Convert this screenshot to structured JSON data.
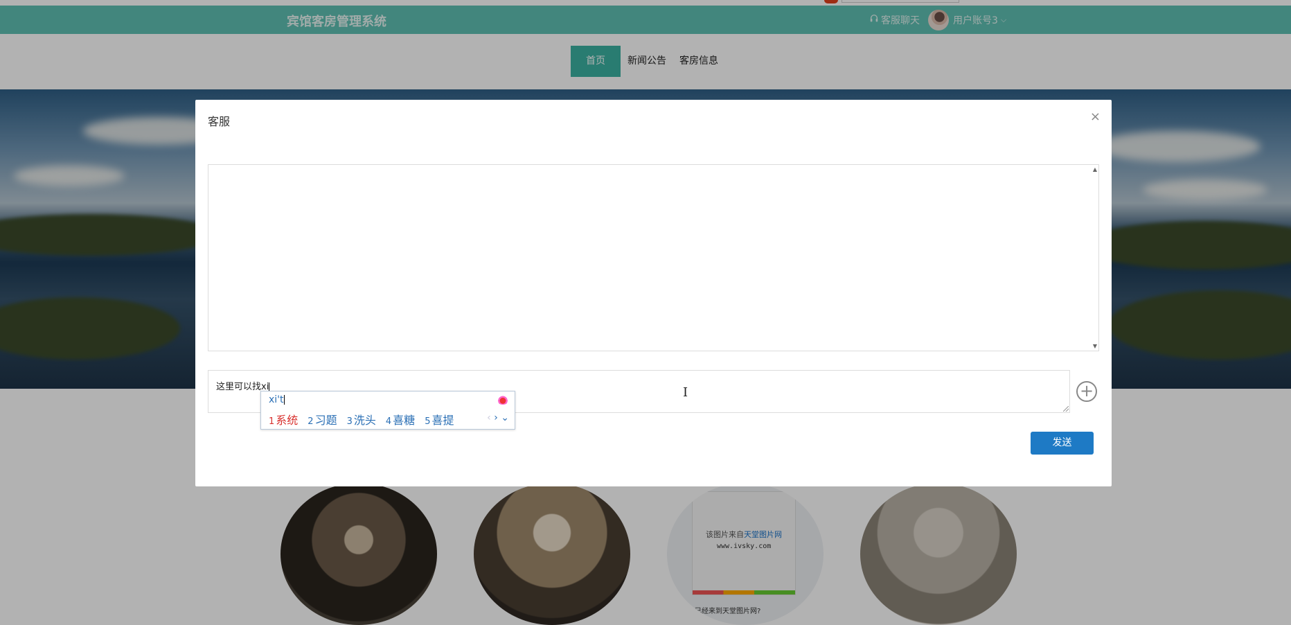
{
  "header": {
    "brand": "宾馆客房管理系统",
    "chat_label": "客服聊天",
    "account_label": "用户账号3",
    "account_chevron": "⌵"
  },
  "nav": {
    "items": [
      {
        "label": "首页",
        "active": true
      },
      {
        "label": "新闻公告",
        "active": false
      },
      {
        "label": "客房信息",
        "active": false
      }
    ]
  },
  "watermark_card": {
    "line1_prefix": "该图片来自",
    "line1_link": "天堂图片网",
    "line2": "www.ivsky.com",
    "line3": "已经来到天堂图片网?"
  },
  "modal": {
    "title": "客服",
    "close": "×",
    "input_value": "这里可以找xi",
    "plus": "+",
    "send_label": "发送"
  },
  "ime": {
    "composition": "xi't",
    "candidates": [
      {
        "num": "1",
        "text": "系统"
      },
      {
        "num": "2",
        "text": "习题"
      },
      {
        "num": "3",
        "text": "洗头"
      },
      {
        "num": "4",
        "text": "喜糖"
      },
      {
        "num": "5",
        "text": "喜提"
      }
    ],
    "prev": "‹",
    "next": "›",
    "expand": "⌄"
  },
  "colors": {
    "header_bg": "#5fc1b4",
    "nav_active": "#3bb2a2",
    "send_button": "#1e7ac5",
    "ime_first_candidate": "#d8302d"
  }
}
